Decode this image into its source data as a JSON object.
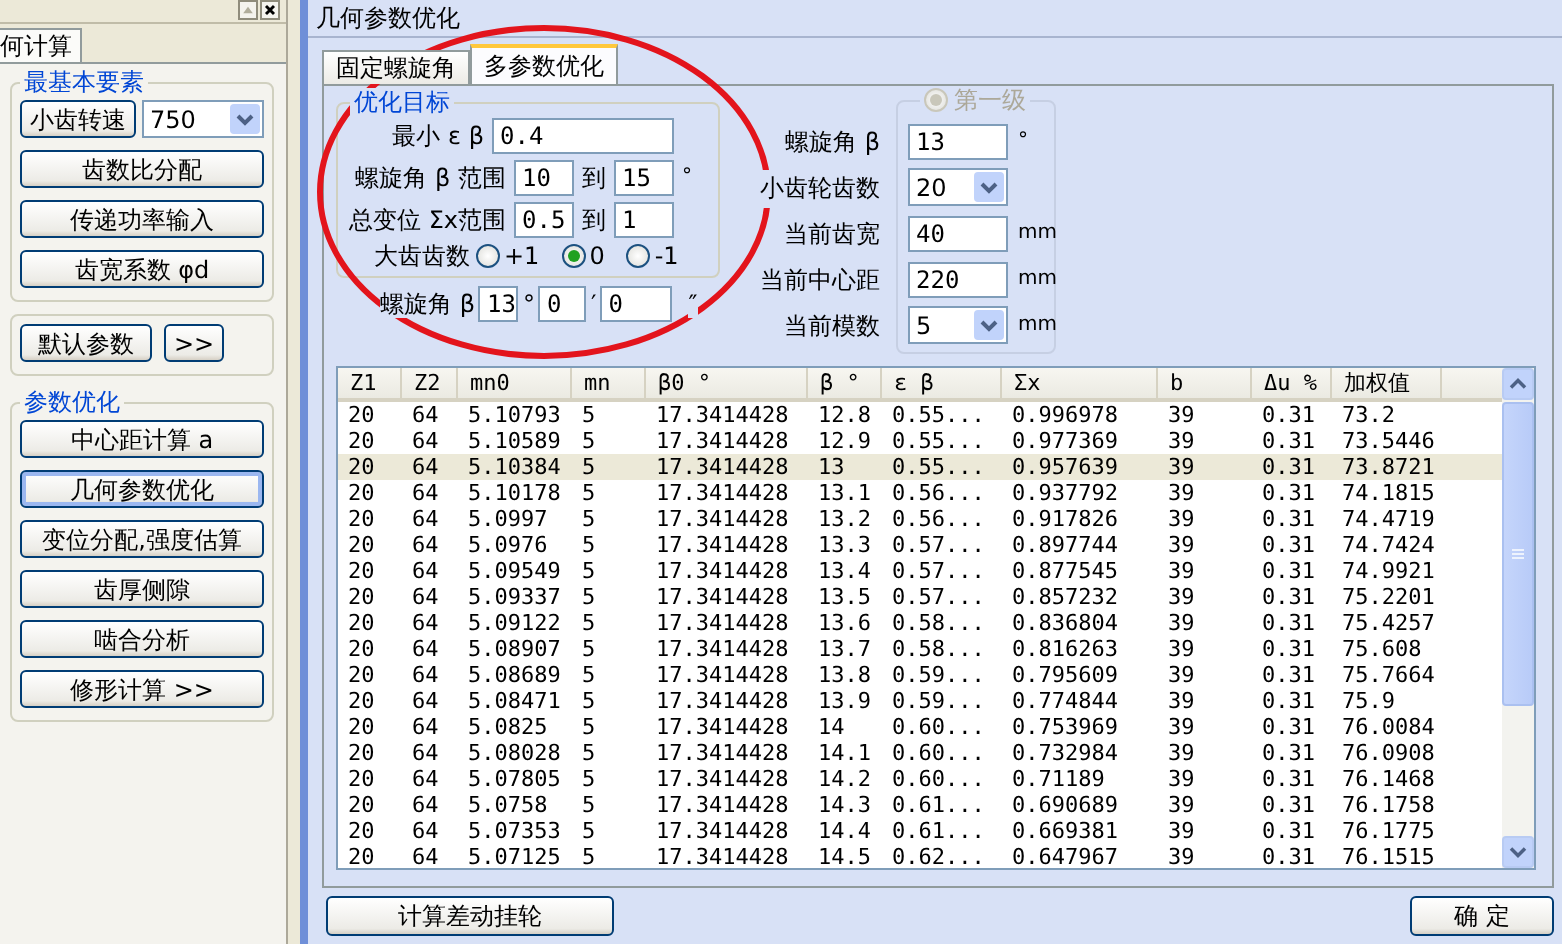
{
  "sidebar": {
    "tab": "何计算",
    "basic_group": {
      "title": "最基本要素",
      "speed_button": "小齿转速",
      "speed_value": "750",
      "buttons": [
        {
          "label": "齿数比分配",
          "selected": false
        },
        {
          "label": "传递功率输入",
          "selected": false
        },
        {
          "label": "齿宽系数 φd",
          "selected": false
        }
      ]
    },
    "default_button": "默认参数",
    "more_button": ">>",
    "optimize_group": {
      "title": "参数优化",
      "buttons": [
        {
          "label": "中心距计算 a",
          "selected": false
        },
        {
          "label": "几何参数优化",
          "selected": true
        },
        {
          "label": "变位分配,强度估算",
          "selected": false
        },
        {
          "label": "齿厚侧隙",
          "selected": false
        },
        {
          "label": "啮合分析",
          "selected": false
        },
        {
          "label": "修形计算  >>",
          "selected": false
        }
      ]
    }
  },
  "dialog": {
    "title": "几何参数优化",
    "tabs": [
      {
        "label": "固定螺旋角",
        "selected": false
      },
      {
        "label": "多参数优化",
        "selected": true
      }
    ],
    "target_group": {
      "title": "优化目标",
      "fields": [
        {
          "kind": "single",
          "label": "最小 ε β",
          "value": "0.4"
        },
        {
          "kind": "range",
          "label": "螺旋角 β 范围",
          "from": "10",
          "to_word": "到",
          "to": "15",
          "unit": "°"
        },
        {
          "kind": "range",
          "label": "总变位 Σx范围",
          "from": "0.5",
          "to_word": "到",
          "to": "1"
        }
      ],
      "radio_label": "大齿齿数",
      "radios": [
        {
          "label": "+1",
          "selected": false
        },
        {
          "label": "0",
          "selected": true
        },
        {
          "label": "-1",
          "selected": false
        }
      ]
    },
    "helix_angle": {
      "label": "螺旋角 β",
      "degrees": "13",
      "degree_mark": "°",
      "minutes": "0",
      "minute_mark": "′",
      "seconds": "0",
      "second_mark": "″"
    },
    "level_group": {
      "title": "第一级",
      "checked": true,
      "disabled": true,
      "fields": [
        {
          "kind": "text",
          "label": "螺旋角 β",
          "value": "13",
          "unit": "°"
        },
        {
          "kind": "select",
          "label": "小齿轮齿数",
          "value": "20"
        },
        {
          "kind": "text",
          "label": "当前齿宽",
          "value": "40",
          "unit": "mm"
        },
        {
          "kind": "text",
          "label": "当前中心距",
          "value": "220",
          "unit": "mm"
        },
        {
          "kind": "select",
          "label": "当前模数",
          "value": "5",
          "unit": "mm"
        }
      ]
    },
    "table": {
      "columns": [
        "Z1",
        "Z2",
        "mn0",
        "mn",
        "β0 °",
        "β °",
        "ε β",
        "Σx",
        "b",
        "Δu %",
        "加权值"
      ],
      "rows": [
        {
          "selected": false,
          "cells": [
            "20",
            "64",
            "5.10793",
            "5",
            "17.3414428",
            "12.8",
            "0.55...",
            "0.996978",
            "39",
            "0.31",
            "73.2"
          ]
        },
        {
          "selected": false,
          "cells": [
            "20",
            "64",
            "5.10589",
            "5",
            "17.3414428",
            "12.9",
            "0.55...",
            "0.977369",
            "39",
            "0.31",
            "73.5446"
          ]
        },
        {
          "selected": true,
          "cells": [
            "20",
            "64",
            "5.10384",
            "5",
            "17.3414428",
            "13",
            "0.55...",
            "0.957639",
            "39",
            "0.31",
            "73.8721"
          ]
        },
        {
          "selected": false,
          "cells": [
            "20",
            "64",
            "5.10178",
            "5",
            "17.3414428",
            "13.1",
            "0.56...",
            "0.937792",
            "39",
            "0.31",
            "74.1815"
          ]
        },
        {
          "selected": false,
          "cells": [
            "20",
            "64",
            "5.0997",
            "5",
            "17.3414428",
            "13.2",
            "0.56...",
            "0.917826",
            "39",
            "0.31",
            "74.4719"
          ]
        },
        {
          "selected": false,
          "cells": [
            "20",
            "64",
            "5.0976",
            "5",
            "17.3414428",
            "13.3",
            "0.57...",
            "0.897744",
            "39",
            "0.31",
            "74.7424"
          ]
        },
        {
          "selected": false,
          "cells": [
            "20",
            "64",
            "5.09549",
            "5",
            "17.3414428",
            "13.4",
            "0.57...",
            "0.877545",
            "39",
            "0.31",
            "74.9921"
          ]
        },
        {
          "selected": false,
          "cells": [
            "20",
            "64",
            "5.09337",
            "5",
            "17.3414428",
            "13.5",
            "0.57...",
            "0.857232",
            "39",
            "0.31",
            "75.2201"
          ]
        },
        {
          "selected": false,
          "cells": [
            "20",
            "64",
            "5.09122",
            "5",
            "17.3414428",
            "13.6",
            "0.58...",
            "0.836804",
            "39",
            "0.31",
            "75.4257"
          ]
        },
        {
          "selected": false,
          "cells": [
            "20",
            "64",
            "5.08907",
            "5",
            "17.3414428",
            "13.7",
            "0.58...",
            "0.816263",
            "39",
            "0.31",
            "75.608"
          ]
        },
        {
          "selected": false,
          "cells": [
            "20",
            "64",
            "5.08689",
            "5",
            "17.3414428",
            "13.8",
            "0.59...",
            "0.795609",
            "39",
            "0.31",
            "75.7664"
          ]
        },
        {
          "selected": false,
          "cells": [
            "20",
            "64",
            "5.08471",
            "5",
            "17.3414428",
            "13.9",
            "0.59...",
            "0.774844",
            "39",
            "0.31",
            "75.9"
          ]
        },
        {
          "selected": false,
          "cells": [
            "20",
            "64",
            "5.0825",
            "5",
            "17.3414428",
            "14",
            "0.60...",
            "0.753969",
            "39",
            "0.31",
            "76.0084"
          ]
        },
        {
          "selected": false,
          "cells": [
            "20",
            "64",
            "5.08028",
            "5",
            "17.3414428",
            "14.1",
            "0.60...",
            "0.732984",
            "39",
            "0.31",
            "76.0908"
          ]
        },
        {
          "selected": false,
          "cells": [
            "20",
            "64",
            "5.07805",
            "5",
            "17.3414428",
            "14.2",
            "0.60...",
            "0.71189",
            "39",
            "0.31",
            "76.1468"
          ]
        },
        {
          "selected": false,
          "cells": [
            "20",
            "64",
            "5.0758",
            "5",
            "17.3414428",
            "14.3",
            "0.61...",
            "0.690689",
            "39",
            "0.31",
            "76.1758"
          ]
        },
        {
          "selected": false,
          "cells": [
            "20",
            "64",
            "5.07353",
            "5",
            "17.3414428",
            "14.4",
            "0.61...",
            "0.669381",
            "39",
            "0.31",
            "76.1775"
          ]
        },
        {
          "selected": false,
          "cells": [
            "20",
            "64",
            "5.07125",
            "5",
            "17.3414428",
            "14.5",
            "0.62...",
            "0.647967",
            "39",
            "0.31",
            "76.1515"
          ]
        }
      ]
    },
    "buttons": [
      {
        "kind": "left",
        "label": "计算差动挂轮"
      },
      {
        "kind": "right",
        "label": "确 定"
      }
    ]
  }
}
